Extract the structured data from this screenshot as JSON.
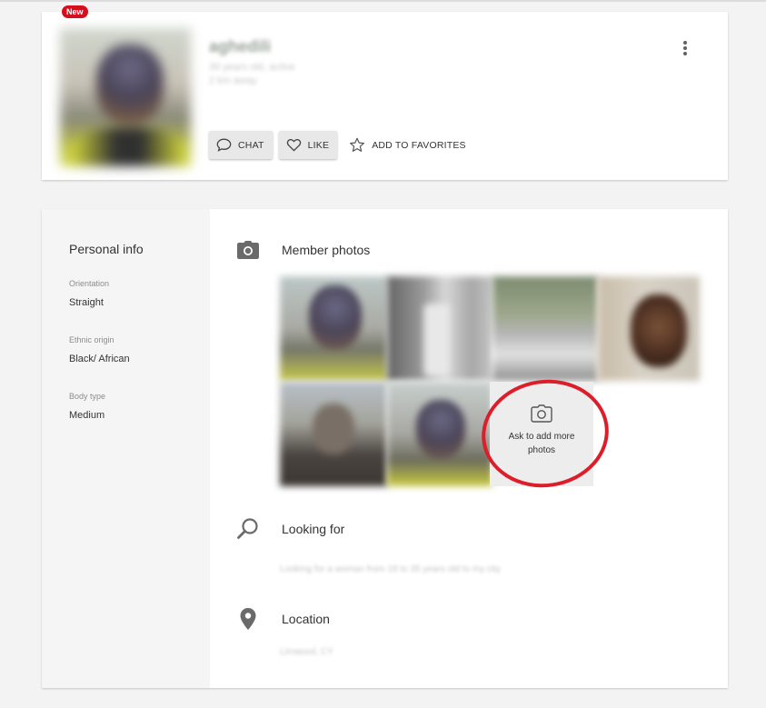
{
  "profile": {
    "badge": "New",
    "username": "aghedili",
    "meta_line1": "39 years old, active",
    "meta_line2": "2 km away",
    "actions": {
      "chat_label": "CHAT",
      "like_label": "LIKE",
      "favorites_label": "ADD TO FAVORITES"
    }
  },
  "personal_info": {
    "title": "Personal info",
    "fields": [
      {
        "label": "Orientation",
        "value": "Straight"
      },
      {
        "label": "Ethnic origin",
        "value": "Black/ African"
      },
      {
        "label": "Body type",
        "value": "Medium"
      }
    ]
  },
  "sections": {
    "photos_title": "Member photos",
    "ask_more_photos": "Ask to add more photos",
    "looking_for_title": "Looking for",
    "looking_for_text": "Looking for a woman from 18 to 35 years old to my city",
    "location_title": "Location",
    "location_text": "Limassol, CY"
  },
  "colors": {
    "badge": "#d60f1e",
    "highlight_circle": "#dc1e2a",
    "sidebar_bg": "#f5f5f5"
  },
  "icons": {
    "chat": "chat-bubble-icon",
    "like": "heart-icon",
    "favorites": "star-icon",
    "more": "more-vert-icon",
    "photos": "camera-icon",
    "looking_for": "search-icon",
    "location": "location-pin-icon"
  }
}
